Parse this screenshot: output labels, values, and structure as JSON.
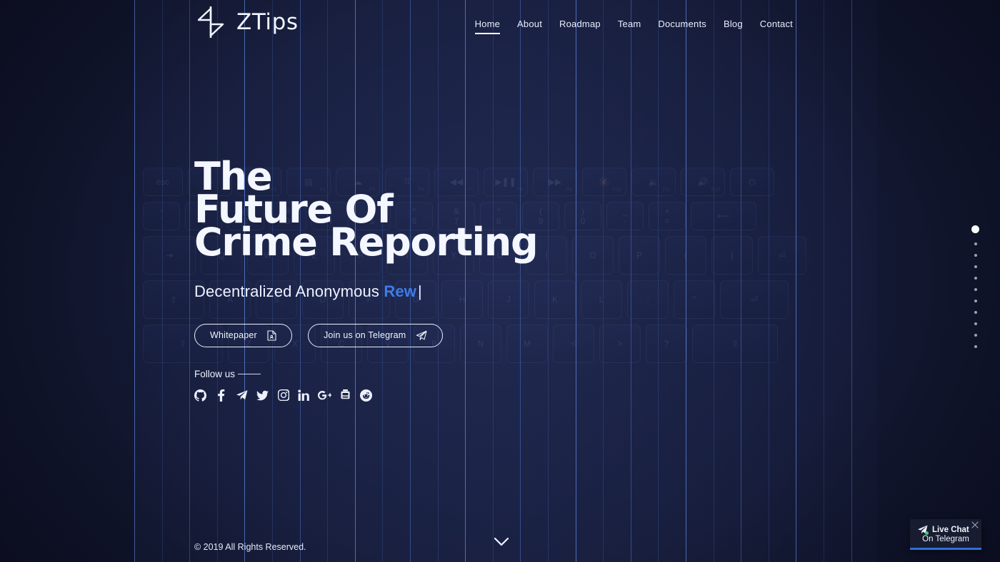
{
  "brand": {
    "name": "ZTips",
    "logo_icon": "ztips-bolt-logo"
  },
  "nav": {
    "items": [
      {
        "label": "Home",
        "active": true
      },
      {
        "label": "About",
        "active": false
      },
      {
        "label": "Roadmap",
        "active": false
      },
      {
        "label": "Team",
        "active": false
      },
      {
        "label": "Documents",
        "active": false
      },
      {
        "label": "Blog",
        "active": false
      },
      {
        "label": "Contact",
        "active": false
      }
    ]
  },
  "hero": {
    "headline_lines": [
      "The",
      "Future Of",
      "Crime Reporting"
    ],
    "tagline_static": "Decentralized Anonymous ",
    "tagline_typed": "Rew",
    "tagline_caret": "|",
    "buttons": [
      {
        "label": "Whitepaper",
        "icon": "document-icon"
      },
      {
        "label": "Join us on Telegram",
        "icon": "telegram-plane-icon"
      }
    ],
    "follow_label": "Follow us",
    "socials": [
      {
        "name": "github-icon",
        "label": "GitHub"
      },
      {
        "name": "facebook-icon",
        "label": "Facebook"
      },
      {
        "name": "telegram-icon",
        "label": "Telegram"
      },
      {
        "name": "twitter-icon",
        "label": "Twitter"
      },
      {
        "name": "instagram-icon",
        "label": "Instagram"
      },
      {
        "name": "linkedin-icon",
        "label": "LinkedIn"
      },
      {
        "name": "google-plus-icon",
        "label": "Google Plus"
      },
      {
        "name": "youtube-icon",
        "label": "YouTube"
      },
      {
        "name": "reddit-icon",
        "label": "Reddit"
      }
    ]
  },
  "section_dots": {
    "count": 11,
    "active_index": 0
  },
  "footer": {
    "copyright": "© 2019 All Rights Reserved.",
    "scroll_icon": "chevron-down-icon"
  },
  "live_chat": {
    "title": "Live Chat",
    "subtitle": "On Telegram",
    "icon": "telegram-plane-icon",
    "status": "online",
    "close_icon": "close-icon"
  },
  "colors": {
    "background_dark": "#0d1024",
    "background_panel": "#1a2040",
    "accent_blue": "#3d7ce8",
    "grid_line": "#4a6fc4",
    "text_primary": "#f2f5ff",
    "chat_bar": "#2f6fd8",
    "status_online": "#3fcf6b"
  },
  "keyboard_bg": {
    "rows": [
      [
        {
          "main": "esc",
          "sub": ""
        },
        {
          "main": "☀",
          "sub": "F2"
        },
        {
          "main": "🔅",
          "sub": "F3"
        },
        {
          "main": "▤",
          "sub": "F4"
        },
        {
          "main": "☁",
          "sub": "F5"
        },
        {
          "main": "⠿",
          "sub": "F6"
        },
        {
          "main": "◀◀",
          "sub": "F7"
        },
        {
          "main": "▶❚❚",
          "sub": "F8"
        },
        {
          "main": "▶▶",
          "sub": "F9"
        },
        {
          "main": "🔇",
          "sub": "F10"
        },
        {
          "main": "🔉",
          "sub": "F11"
        },
        {
          "main": "🔊",
          "sub": "F12"
        },
        {
          "main": "⏻",
          "sub": ""
        }
      ],
      [
        {
          "top": "~",
          "bottom": "`"
        },
        {
          "top": "!",
          "bottom": "1"
        },
        {
          "top": "@",
          "bottom": "2"
        },
        {
          "top": "#",
          "bottom": "3"
        },
        {
          "top": "$",
          "bottom": "4"
        },
        {
          "top": "%",
          "bottom": "5"
        },
        {
          "top": "^",
          "bottom": "6"
        },
        {
          "top": "&",
          "bottom": "7"
        },
        {
          "top": "*",
          "bottom": "8"
        },
        {
          "top": "(",
          "bottom": "9"
        },
        {
          "top": ")",
          "bottom": "0"
        },
        {
          "top": "_",
          "bottom": "-"
        },
        {
          "top": "+",
          "bottom": "="
        },
        {
          "top": "",
          "bottom": "⟵"
        }
      ],
      [
        {
          "main": "⇥"
        },
        {
          "main": "Q"
        },
        {
          "main": "W"
        },
        {
          "main": "E"
        },
        {
          "main": "R"
        },
        {
          "main": "T"
        },
        {
          "main": "Y"
        },
        {
          "main": "U"
        },
        {
          "main": "I"
        },
        {
          "main": "O"
        },
        {
          "main": "P"
        },
        {
          "main": "{"
        },
        {
          "main": "}"
        },
        {
          "main": "⏎"
        }
      ],
      [
        {
          "main": "⇪"
        },
        {
          "main": "A"
        },
        {
          "main": "S"
        },
        {
          "main": "D"
        },
        {
          "main": "F"
        },
        {
          "main": "G"
        },
        {
          "main": "H"
        },
        {
          "main": "J"
        },
        {
          "main": "K"
        },
        {
          "main": "L"
        },
        {
          "main": ":"
        },
        {
          "main": "\""
        },
        {
          "main": "⏎"
        }
      ],
      [
        {
          "main": "⇧"
        },
        {
          "main": "Z"
        },
        {
          "main": "X"
        },
        {
          "main": "C"
        },
        {
          "main": "V"
        },
        {
          "main": "B"
        },
        {
          "main": "N"
        },
        {
          "main": "M"
        },
        {
          "main": "<"
        },
        {
          "main": ">"
        },
        {
          "main": "?"
        },
        {
          "main": "⇧"
        }
      ]
    ]
  }
}
